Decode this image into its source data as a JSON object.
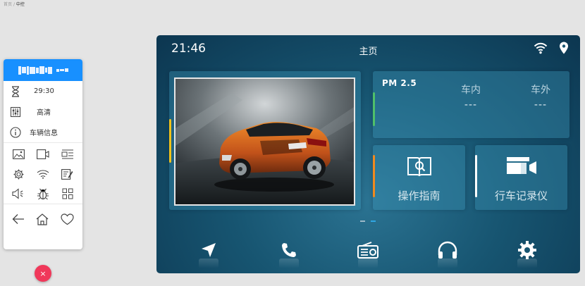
{
  "breadcrumb": {
    "home": "首页",
    "separator": "/",
    "current": "中控"
  },
  "panel": {
    "timer_value": "29:30",
    "quality_label": "高清",
    "info_label": "车辆信息",
    "grid_icons": [
      "image-icon",
      "video-icon",
      "layout-icon",
      "gear-icon",
      "wifi-icon",
      "note-icon",
      "volume-icon",
      "bug-icon",
      "apps-grid-icon"
    ],
    "nav_icons": [
      "back-arrow-icon",
      "home-icon",
      "heart-icon"
    ]
  },
  "fab": {
    "glyph": "×"
  },
  "screen": {
    "time": "21:46",
    "title": "主页",
    "pm": {
      "label": "PM 2.5",
      "inside_label": "车内",
      "inside_value": "---",
      "outside_label": "车外",
      "outside_value": "---"
    },
    "tiles": [
      {
        "label": "操作指南",
        "icon": "book-search-icon"
      },
      {
        "label": "行车记录仪",
        "icon": "dashcam-icon"
      }
    ],
    "page_indicator": {
      "count": 2,
      "active": 2
    },
    "dock": [
      "navigation-icon",
      "phone-icon",
      "radio-icon",
      "headphones-icon",
      "settings-icon"
    ]
  },
  "colors": {
    "accent": "#1890ff",
    "fab": "#f0385a",
    "accent_yellow": "#f2c21a",
    "accent_orange": "#f08a1e",
    "accent_green": "#4fc06a"
  }
}
